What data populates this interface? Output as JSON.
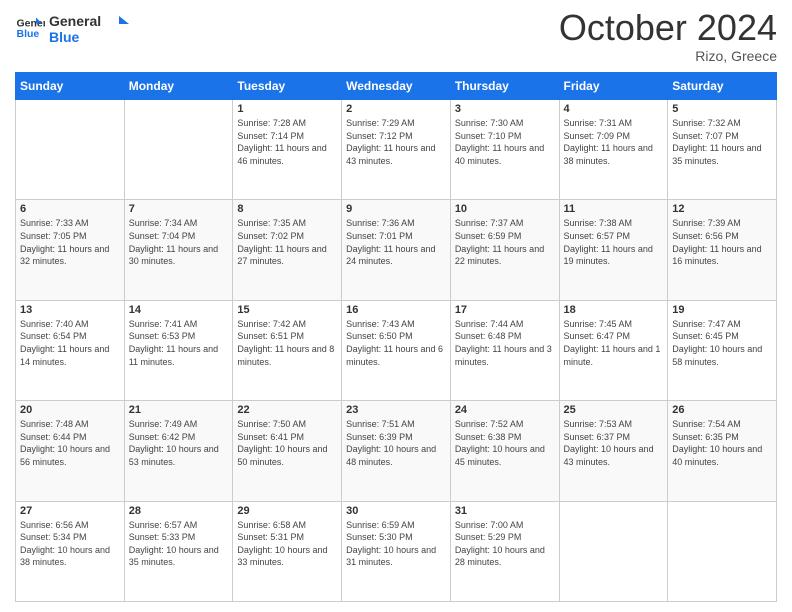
{
  "logo": {
    "line1": "General",
    "line2": "Blue"
  },
  "title": "October 2024",
  "location": "Rizo, Greece",
  "weekdays": [
    "Sunday",
    "Monday",
    "Tuesday",
    "Wednesday",
    "Thursday",
    "Friday",
    "Saturday"
  ],
  "weeks": [
    [
      null,
      null,
      {
        "day": 1,
        "sunrise": "7:28 AM",
        "sunset": "7:14 PM",
        "daylight": "11 hours and 46 minutes."
      },
      {
        "day": 2,
        "sunrise": "7:29 AM",
        "sunset": "7:12 PM",
        "daylight": "11 hours and 43 minutes."
      },
      {
        "day": 3,
        "sunrise": "7:30 AM",
        "sunset": "7:10 PM",
        "daylight": "11 hours and 40 minutes."
      },
      {
        "day": 4,
        "sunrise": "7:31 AM",
        "sunset": "7:09 PM",
        "daylight": "11 hours and 38 minutes."
      },
      {
        "day": 5,
        "sunrise": "7:32 AM",
        "sunset": "7:07 PM",
        "daylight": "11 hours and 35 minutes."
      }
    ],
    [
      {
        "day": 6,
        "sunrise": "7:33 AM",
        "sunset": "7:05 PM",
        "daylight": "11 hours and 32 minutes."
      },
      {
        "day": 7,
        "sunrise": "7:34 AM",
        "sunset": "7:04 PM",
        "daylight": "11 hours and 30 minutes."
      },
      {
        "day": 8,
        "sunrise": "7:35 AM",
        "sunset": "7:02 PM",
        "daylight": "11 hours and 27 minutes."
      },
      {
        "day": 9,
        "sunrise": "7:36 AM",
        "sunset": "7:01 PM",
        "daylight": "11 hours and 24 minutes."
      },
      {
        "day": 10,
        "sunrise": "7:37 AM",
        "sunset": "6:59 PM",
        "daylight": "11 hours and 22 minutes."
      },
      {
        "day": 11,
        "sunrise": "7:38 AM",
        "sunset": "6:57 PM",
        "daylight": "11 hours and 19 minutes."
      },
      {
        "day": 12,
        "sunrise": "7:39 AM",
        "sunset": "6:56 PM",
        "daylight": "11 hours and 16 minutes."
      }
    ],
    [
      {
        "day": 13,
        "sunrise": "7:40 AM",
        "sunset": "6:54 PM",
        "daylight": "11 hours and 14 minutes."
      },
      {
        "day": 14,
        "sunrise": "7:41 AM",
        "sunset": "6:53 PM",
        "daylight": "11 hours and 11 minutes."
      },
      {
        "day": 15,
        "sunrise": "7:42 AM",
        "sunset": "6:51 PM",
        "daylight": "11 hours and 8 minutes."
      },
      {
        "day": 16,
        "sunrise": "7:43 AM",
        "sunset": "6:50 PM",
        "daylight": "11 hours and 6 minutes."
      },
      {
        "day": 17,
        "sunrise": "7:44 AM",
        "sunset": "6:48 PM",
        "daylight": "11 hours and 3 minutes."
      },
      {
        "day": 18,
        "sunrise": "7:45 AM",
        "sunset": "6:47 PM",
        "daylight": "11 hours and 1 minute."
      },
      {
        "day": 19,
        "sunrise": "7:47 AM",
        "sunset": "6:45 PM",
        "daylight": "10 hours and 58 minutes."
      }
    ],
    [
      {
        "day": 20,
        "sunrise": "7:48 AM",
        "sunset": "6:44 PM",
        "daylight": "10 hours and 56 minutes."
      },
      {
        "day": 21,
        "sunrise": "7:49 AM",
        "sunset": "6:42 PM",
        "daylight": "10 hours and 53 minutes."
      },
      {
        "day": 22,
        "sunrise": "7:50 AM",
        "sunset": "6:41 PM",
        "daylight": "10 hours and 50 minutes."
      },
      {
        "day": 23,
        "sunrise": "7:51 AM",
        "sunset": "6:39 PM",
        "daylight": "10 hours and 48 minutes."
      },
      {
        "day": 24,
        "sunrise": "7:52 AM",
        "sunset": "6:38 PM",
        "daylight": "10 hours and 45 minutes."
      },
      {
        "day": 25,
        "sunrise": "7:53 AM",
        "sunset": "6:37 PM",
        "daylight": "10 hours and 43 minutes."
      },
      {
        "day": 26,
        "sunrise": "7:54 AM",
        "sunset": "6:35 PM",
        "daylight": "10 hours and 40 minutes."
      }
    ],
    [
      {
        "day": 27,
        "sunrise": "6:56 AM",
        "sunset": "5:34 PM",
        "daylight": "10 hours and 38 minutes."
      },
      {
        "day": 28,
        "sunrise": "6:57 AM",
        "sunset": "5:33 PM",
        "daylight": "10 hours and 35 minutes."
      },
      {
        "day": 29,
        "sunrise": "6:58 AM",
        "sunset": "5:31 PM",
        "daylight": "10 hours and 33 minutes."
      },
      {
        "day": 30,
        "sunrise": "6:59 AM",
        "sunset": "5:30 PM",
        "daylight": "10 hours and 31 minutes."
      },
      {
        "day": 31,
        "sunrise": "7:00 AM",
        "sunset": "5:29 PM",
        "daylight": "10 hours and 28 minutes."
      },
      null,
      null
    ]
  ]
}
